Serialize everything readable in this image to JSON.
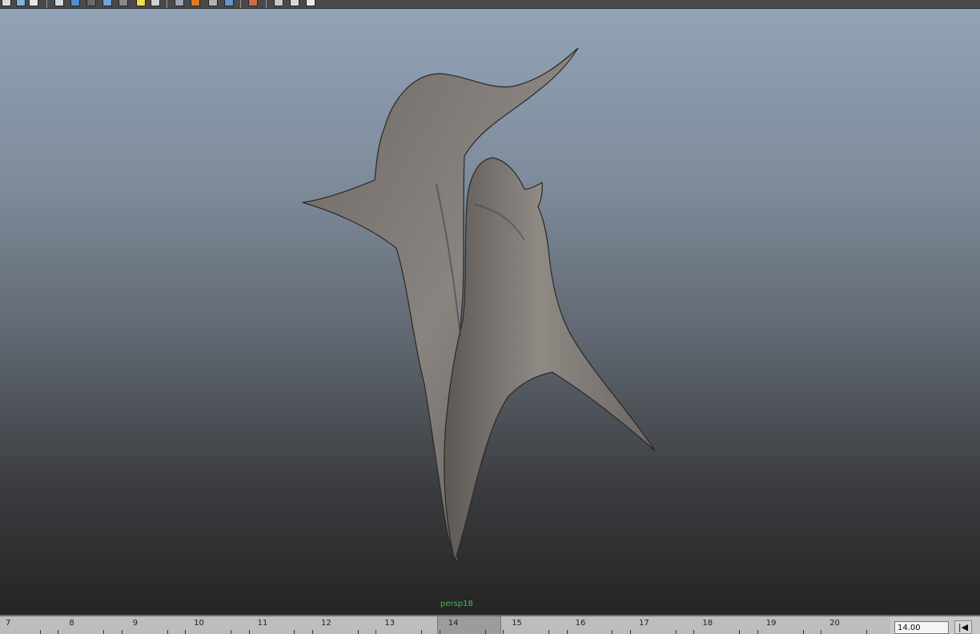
{
  "toolbar": {
    "buttons": [
      {
        "icon": "create-polygon-icon",
        "color": "#d9d9d9"
      },
      {
        "icon": "render-view-icon",
        "color": "#7fb2e0"
      },
      {
        "icon": "info-icon",
        "color": "#e6e6e6"
      },
      {
        "icon": "wireframe-cube-icon",
        "color": "#cfd8e0"
      },
      {
        "icon": "smooth-shade-cube-icon",
        "color": "#4f8fd0"
      },
      {
        "icon": "shaded-wire-icon",
        "color": "#6a6a6a"
      },
      {
        "icon": "textured-cube-icon",
        "color": "#6fa6de"
      },
      {
        "icon": "use-lights-icon",
        "color": "#8a8a8a"
      },
      {
        "icon": "default-light-icon",
        "color": "#f2d94a"
      },
      {
        "icon": "shadows-icon",
        "color": "#d0d0d0"
      },
      {
        "icon": "xray-icon",
        "color": "#9aa7b5"
      },
      {
        "icon": "ambient-occlusion-icon",
        "color": "#e07a1e"
      },
      {
        "icon": "motion-blur-icon",
        "color": "#b0b0b0"
      },
      {
        "icon": "anti-alias-icon",
        "color": "#5e96d6"
      },
      {
        "icon": "isolate-select-icon",
        "color": "#d06a4a"
      },
      {
        "icon": "xray-joints-icon",
        "color": "#c8c8c8"
      },
      {
        "icon": "camera-attributes-icon",
        "color": "#d8d8d8"
      },
      {
        "icon": "bookmark-icon",
        "color": "#e8e8e8"
      }
    ]
  },
  "viewport": {
    "camera_label": "persp18"
  },
  "timeline": {
    "frames": [
      "7",
      "8",
      "9",
      "10",
      "11",
      "12",
      "13",
      "14",
      "15",
      "16",
      "17",
      "18",
      "19",
      "20"
    ],
    "current_frame": 14,
    "current_time_value": "14.00",
    "go_to_start_label": "|◀"
  }
}
